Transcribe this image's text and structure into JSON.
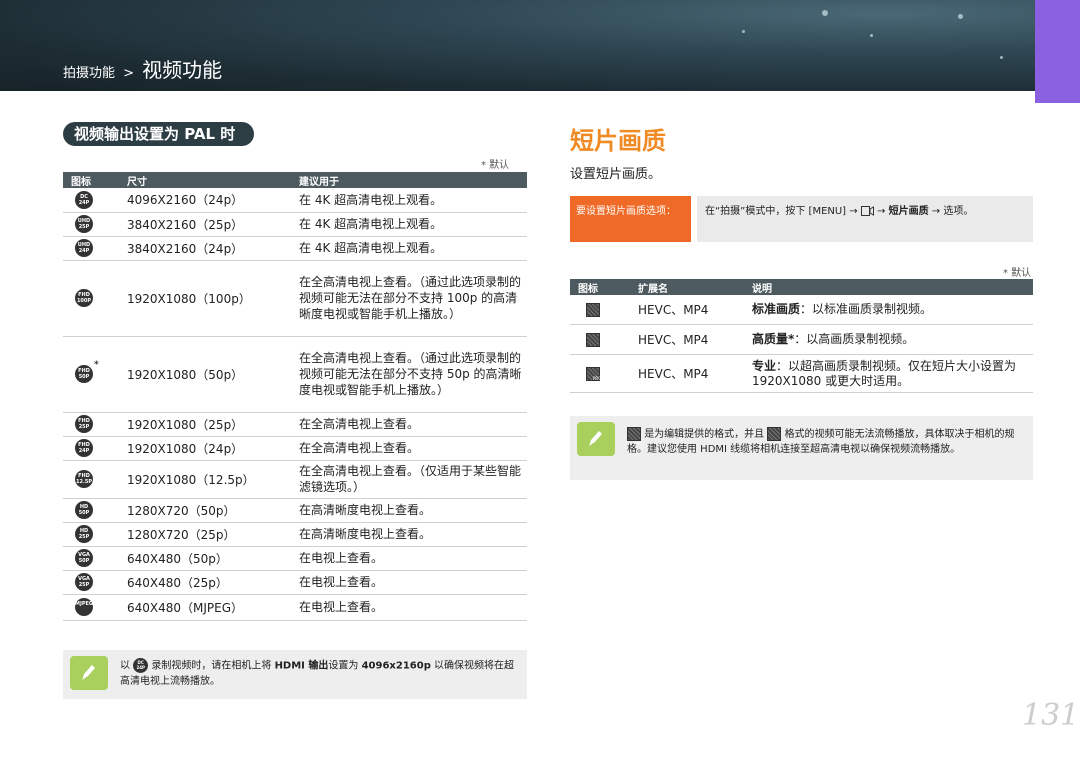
{
  "header": {
    "breadcrumb_small": "拍摄功能",
    "breadcrumb_sep": ">",
    "breadcrumb_big": "视频功能"
  },
  "left": {
    "section_label": "视频输出设置为 PAL 时",
    "default_note": "* 默认",
    "table": {
      "headers": [
        "图标",
        "尺寸",
        "建议用于"
      ],
      "rows": [
        {
          "icon": "4096x2160-24p-icon",
          "icon_top": "DC",
          "icon_bottom": "24P",
          "size": "4096X2160（24p）",
          "use": "在 4K 超高清电视上观看。"
        },
        {
          "icon": "3840x2160-25p-icon",
          "icon_top": "UHD",
          "icon_bottom": "25P",
          "size": "3840X2160（25p）",
          "use": "在 4K 超高清电视上观看。"
        },
        {
          "icon": "3840x2160-24p-icon",
          "icon_top": "UHD",
          "icon_bottom": "24P",
          "size": "3840X2160（24p）",
          "use": "在 4K 超高清电视上观看。"
        },
        {
          "icon": "1920x1080-100p-icon",
          "icon_top": "FHD",
          "icon_bottom": "100P",
          "size": "1920X1080（100p）",
          "use": "在全高清电视上查看。（通过此选项录制的视频可能无法在部分不支持 100p 的高清晰度电视或智能手机上播放。）"
        },
        {
          "icon": "1920x1080-50p-icon",
          "icon_top": "FHD",
          "icon_bottom": "50P",
          "default_mark": "*",
          "size": "1920X1080（50p）",
          "use": "在全高清电视上查看。（通过此选项录制的视频可能无法在部分不支持 50p 的高清晰度电视或智能手机上播放。）"
        },
        {
          "icon": "1920x1080-25p-icon",
          "icon_top": "FHD",
          "icon_bottom": "25P",
          "size": "1920X1080（25p）",
          "use": "在全高清电视上查看。"
        },
        {
          "icon": "1920x1080-24p-icon",
          "icon_top": "FHD",
          "icon_bottom": "24P",
          "size": "1920X1080（24p）",
          "use": "在全高清电视上查看。"
        },
        {
          "icon": "1920x1080-12.5p-icon",
          "icon_top": "FHD",
          "icon_bottom": "12.5P",
          "size": "1920X1080（12.5p）",
          "use": "在全高清电视上查看。（仅适用于某些智能滤镜选项。）"
        },
        {
          "icon": "1280x720-50p-icon",
          "icon_top": "HD",
          "icon_bottom": "50P",
          "size": "1280X720（50p）",
          "use": "在高清晰度电视上查看。"
        },
        {
          "icon": "1280x720-25p-icon",
          "icon_top": "HD",
          "icon_bottom": "25P",
          "size": "1280X720（25p）",
          "use": "在高清晰度电视上查看。"
        },
        {
          "icon": "640x480-50p-icon",
          "icon_top": "VGA",
          "icon_bottom": "50P",
          "size": "640X480（50p）",
          "use": "在电视上查看。"
        },
        {
          "icon": "640x480-25p-icon",
          "icon_top": "VGA",
          "icon_bottom": "25P",
          "size": "640X480（25p）",
          "use": "在电视上查看。"
        },
        {
          "icon": "640x480-mjpeg-icon",
          "icon_top": "MJPEG",
          "icon_bottom": "",
          "size": "640X480（MJPEG）",
          "use": "在电视上查看。"
        }
      ]
    },
    "note": {
      "prefix": "以",
      "icon_top": "DC",
      "icon_bottom": "24P",
      "text_a": "录制视频时，请在相机上将",
      "bold_a": "HDMI 输出",
      "text_b": "设置为",
      "bold_b": "4096x2160p",
      "text_c": "以确保视频将在超高清电视上流畅播放。"
    }
  },
  "right": {
    "title": "短片画质",
    "subtitle": "设置短片画质。",
    "orange_label": "要设置短片画质选项：",
    "instruction_a": "在“拍摄”模式中，按下 [MENU] →",
    "instruction_b": "→",
    "instruction_bold": "短片画质",
    "instruction_c": "→ 选项。",
    "default_note": "* 默认",
    "table": {
      "headers": [
        "图标",
        "扩展名",
        "说明"
      ],
      "rows": [
        {
          "icon": "standard-quality-icon",
          "ext": "HEVC、MP4",
          "bold": "标准画质",
          "desc": "：以标准画质录制视频。"
        },
        {
          "icon": "high-quality-icon",
          "ext": "HEVC、MP4",
          "bold": "高质量*",
          "desc": "：以高画质录制视频。"
        },
        {
          "icon": "pro-quality-icon",
          "ext": "HEVC、MP4",
          "bold": "专业",
          "desc": "：以超高画质录制视频。仅在短片大小设置为 1920X1080 或更大时适用。"
        }
      ]
    },
    "note": {
      "text_a": "是为编辑提供的格式，并且",
      "text_b": "格式的视频可能无法流畅播放，具体取决于相机的规格。建议您使用 HDMI 线缆将相机连接至超高清电视以确保视频流畅播放。"
    }
  },
  "page_number": "131"
}
